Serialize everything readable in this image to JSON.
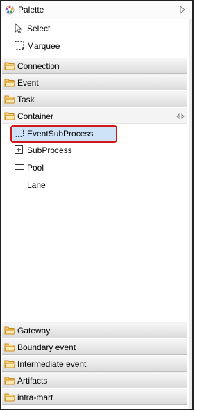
{
  "header": {
    "title": "Palette"
  },
  "tools": [
    {
      "label": "Select",
      "icon": "pointer-icon"
    },
    {
      "label": "Marquee",
      "icon": "marquee-icon"
    }
  ],
  "drawers_top": [
    {
      "label": "Connection"
    },
    {
      "label": "Event"
    },
    {
      "label": "Task"
    }
  ],
  "container": {
    "label": "Container",
    "items": [
      {
        "label": "EventSubProcess",
        "icon": "event-subprocess-icon",
        "selected": true
      },
      {
        "label": "SubProcess",
        "icon": "subprocess-icon"
      },
      {
        "label": "Pool",
        "icon": "pool-icon"
      },
      {
        "label": "Lane",
        "icon": "lane-icon"
      }
    ]
  },
  "drawers_bottom": [
    {
      "label": "Gateway"
    },
    {
      "label": "Boundary event"
    },
    {
      "label": "Intermediate event"
    },
    {
      "label": "Artifacts"
    },
    {
      "label": "intra-mart"
    }
  ],
  "colors": {
    "selection_bg": "#cfe3f8",
    "highlight_border": "#d01818",
    "folder": "#f0b53c"
  }
}
